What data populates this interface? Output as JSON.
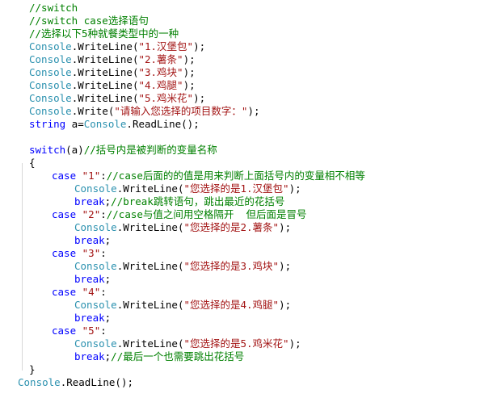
{
  "editor": {
    "lines": [
      {
        "indent": 36,
        "tokens": [
          {
            "c": "cm",
            "t": "//switch"
          }
        ]
      },
      {
        "indent": 36,
        "tokens": [
          {
            "c": "cm",
            "t": "//switch case选择语句"
          }
        ]
      },
      {
        "indent": 36,
        "tokens": [
          {
            "c": "cm",
            "t": "//选择以下5种就餐类型中的一种"
          }
        ]
      },
      {
        "indent": 36,
        "tokens": [
          {
            "c": "type",
            "t": "Console"
          },
          {
            "c": "plain",
            "t": ".WriteLine("
          },
          {
            "c": "str",
            "t": "\"1.汉堡包\""
          },
          {
            "c": "plain",
            "t": ");"
          }
        ]
      },
      {
        "indent": 36,
        "tokens": [
          {
            "c": "type",
            "t": "Console"
          },
          {
            "c": "plain",
            "t": ".WriteLine("
          },
          {
            "c": "str",
            "t": "\"2.薯条\""
          },
          {
            "c": "plain",
            "t": ");"
          }
        ]
      },
      {
        "indent": 36,
        "tokens": [
          {
            "c": "type",
            "t": "Console"
          },
          {
            "c": "plain",
            "t": ".WriteLine("
          },
          {
            "c": "str",
            "t": "\"3.鸡块\""
          },
          {
            "c": "plain",
            "t": ");"
          }
        ]
      },
      {
        "indent": 36,
        "tokens": [
          {
            "c": "type",
            "t": "Console"
          },
          {
            "c": "plain",
            "t": ".WriteLine("
          },
          {
            "c": "str",
            "t": "\"4.鸡腿\""
          },
          {
            "c": "plain",
            "t": ");"
          }
        ]
      },
      {
        "indent": 36,
        "tokens": [
          {
            "c": "type",
            "t": "Console"
          },
          {
            "c": "plain",
            "t": ".WriteLine("
          },
          {
            "c": "str",
            "t": "\"5.鸡米花\""
          },
          {
            "c": "plain",
            "t": ");"
          }
        ]
      },
      {
        "indent": 36,
        "tokens": [
          {
            "c": "type",
            "t": "Console"
          },
          {
            "c": "plain",
            "t": ".Write("
          },
          {
            "c": "str",
            "t": "\"请输入您选择的项目数字：\""
          },
          {
            "c": "plain",
            "t": ");"
          }
        ]
      },
      {
        "indent": 36,
        "tokens": [
          {
            "c": "kw",
            "t": "string"
          },
          {
            "c": "plain",
            "t": " a="
          },
          {
            "c": "type",
            "t": "Console"
          },
          {
            "c": "plain",
            "t": ".ReadLine();"
          }
        ]
      },
      {
        "indent": 36,
        "tokens": []
      },
      {
        "indent": 36,
        "tokens": [
          {
            "c": "kw",
            "t": "switch"
          },
          {
            "c": "plain",
            "t": "(a)"
          },
          {
            "c": "cm",
            "t": "//括号内是被判断的变量名称"
          }
        ]
      },
      {
        "indent": 36,
        "tokens": [
          {
            "c": "plain",
            "t": "{"
          }
        ]
      },
      {
        "indent": 64,
        "tokens": [
          {
            "c": "kw",
            "t": "case"
          },
          {
            "c": "plain",
            "t": " "
          },
          {
            "c": "str",
            "t": "\"1\""
          },
          {
            "c": "plain",
            "t": ":"
          },
          {
            "c": "cm",
            "t": "//case后面的的值是用来判断上面括号内的变量相不相等"
          }
        ]
      },
      {
        "indent": 92,
        "tokens": [
          {
            "c": "type",
            "t": "Console"
          },
          {
            "c": "plain",
            "t": ".WriteLine("
          },
          {
            "c": "str",
            "t": "\"您选择的是1.汉堡包\""
          },
          {
            "c": "plain",
            "t": ");"
          }
        ]
      },
      {
        "indent": 92,
        "tokens": [
          {
            "c": "kw",
            "t": "break"
          },
          {
            "c": "plain",
            "t": ";"
          },
          {
            "c": "cm",
            "t": "//break跳转语句，跳出最近的花括号"
          }
        ]
      },
      {
        "indent": 64,
        "tokens": [
          {
            "c": "kw",
            "t": "case"
          },
          {
            "c": "plain",
            "t": " "
          },
          {
            "c": "str",
            "t": "\"2\""
          },
          {
            "c": "plain",
            "t": ":"
          },
          {
            "c": "cm",
            "t": "//case与值之间用空格隔开  但后面是冒号"
          }
        ]
      },
      {
        "indent": 92,
        "tokens": [
          {
            "c": "type",
            "t": "Console"
          },
          {
            "c": "plain",
            "t": ".WriteLine("
          },
          {
            "c": "str",
            "t": "\"您选择的是2.薯条\""
          },
          {
            "c": "plain",
            "t": ");"
          }
        ]
      },
      {
        "indent": 92,
        "tokens": [
          {
            "c": "kw",
            "t": "break"
          },
          {
            "c": "plain",
            "t": ";"
          }
        ]
      },
      {
        "indent": 64,
        "tokens": [
          {
            "c": "kw",
            "t": "case"
          },
          {
            "c": "plain",
            "t": " "
          },
          {
            "c": "str",
            "t": "\"3\""
          },
          {
            "c": "plain",
            "t": ":"
          }
        ]
      },
      {
        "indent": 92,
        "tokens": [
          {
            "c": "type",
            "t": "Console"
          },
          {
            "c": "plain",
            "t": ".WriteLine("
          },
          {
            "c": "str",
            "t": "\"您选择的是3.鸡块\""
          },
          {
            "c": "plain",
            "t": ");"
          }
        ]
      },
      {
        "indent": 92,
        "tokens": [
          {
            "c": "kw",
            "t": "break"
          },
          {
            "c": "plain",
            "t": ";"
          }
        ]
      },
      {
        "indent": 64,
        "tokens": [
          {
            "c": "kw",
            "t": "case"
          },
          {
            "c": "plain",
            "t": " "
          },
          {
            "c": "str",
            "t": "\"4\""
          },
          {
            "c": "plain",
            "t": ":"
          }
        ]
      },
      {
        "indent": 92,
        "tokens": [
          {
            "c": "type",
            "t": "Console"
          },
          {
            "c": "plain",
            "t": ".WriteLine("
          },
          {
            "c": "str",
            "t": "\"您选择的是4.鸡腿\""
          },
          {
            "c": "plain",
            "t": ");"
          }
        ]
      },
      {
        "indent": 92,
        "tokens": [
          {
            "c": "kw",
            "t": "break"
          },
          {
            "c": "plain",
            "t": ";"
          }
        ]
      },
      {
        "indent": 64,
        "tokens": [
          {
            "c": "kw",
            "t": "case"
          },
          {
            "c": "plain",
            "t": " "
          },
          {
            "c": "str",
            "t": "\"5\""
          },
          {
            "c": "plain",
            "t": ":"
          }
        ]
      },
      {
        "indent": 92,
        "tokens": [
          {
            "c": "type",
            "t": "Console"
          },
          {
            "c": "plain",
            "t": ".WriteLine("
          },
          {
            "c": "str",
            "t": "\"您选择的是5.鸡米花\""
          },
          {
            "c": "plain",
            "t": ");"
          }
        ]
      },
      {
        "indent": 92,
        "tokens": [
          {
            "c": "kw",
            "t": "break"
          },
          {
            "c": "plain",
            "t": ";"
          },
          {
            "c": "cm",
            "t": "//最后一个也需要跳出花括号"
          }
        ]
      },
      {
        "indent": 36,
        "tokens": [
          {
            "c": "plain",
            "t": "}"
          }
        ]
      },
      {
        "indent": 22,
        "tokens": [
          {
            "c": "type",
            "t": "Console"
          },
          {
            "c": "plain",
            "t": ".ReadLine();"
          }
        ]
      }
    ]
  },
  "colors": {
    "keyword": "#0000ff",
    "type": "#2b91af",
    "string": "#a31515",
    "comment": "#008000",
    "plain": "#000000",
    "background": "#ffffff"
  }
}
